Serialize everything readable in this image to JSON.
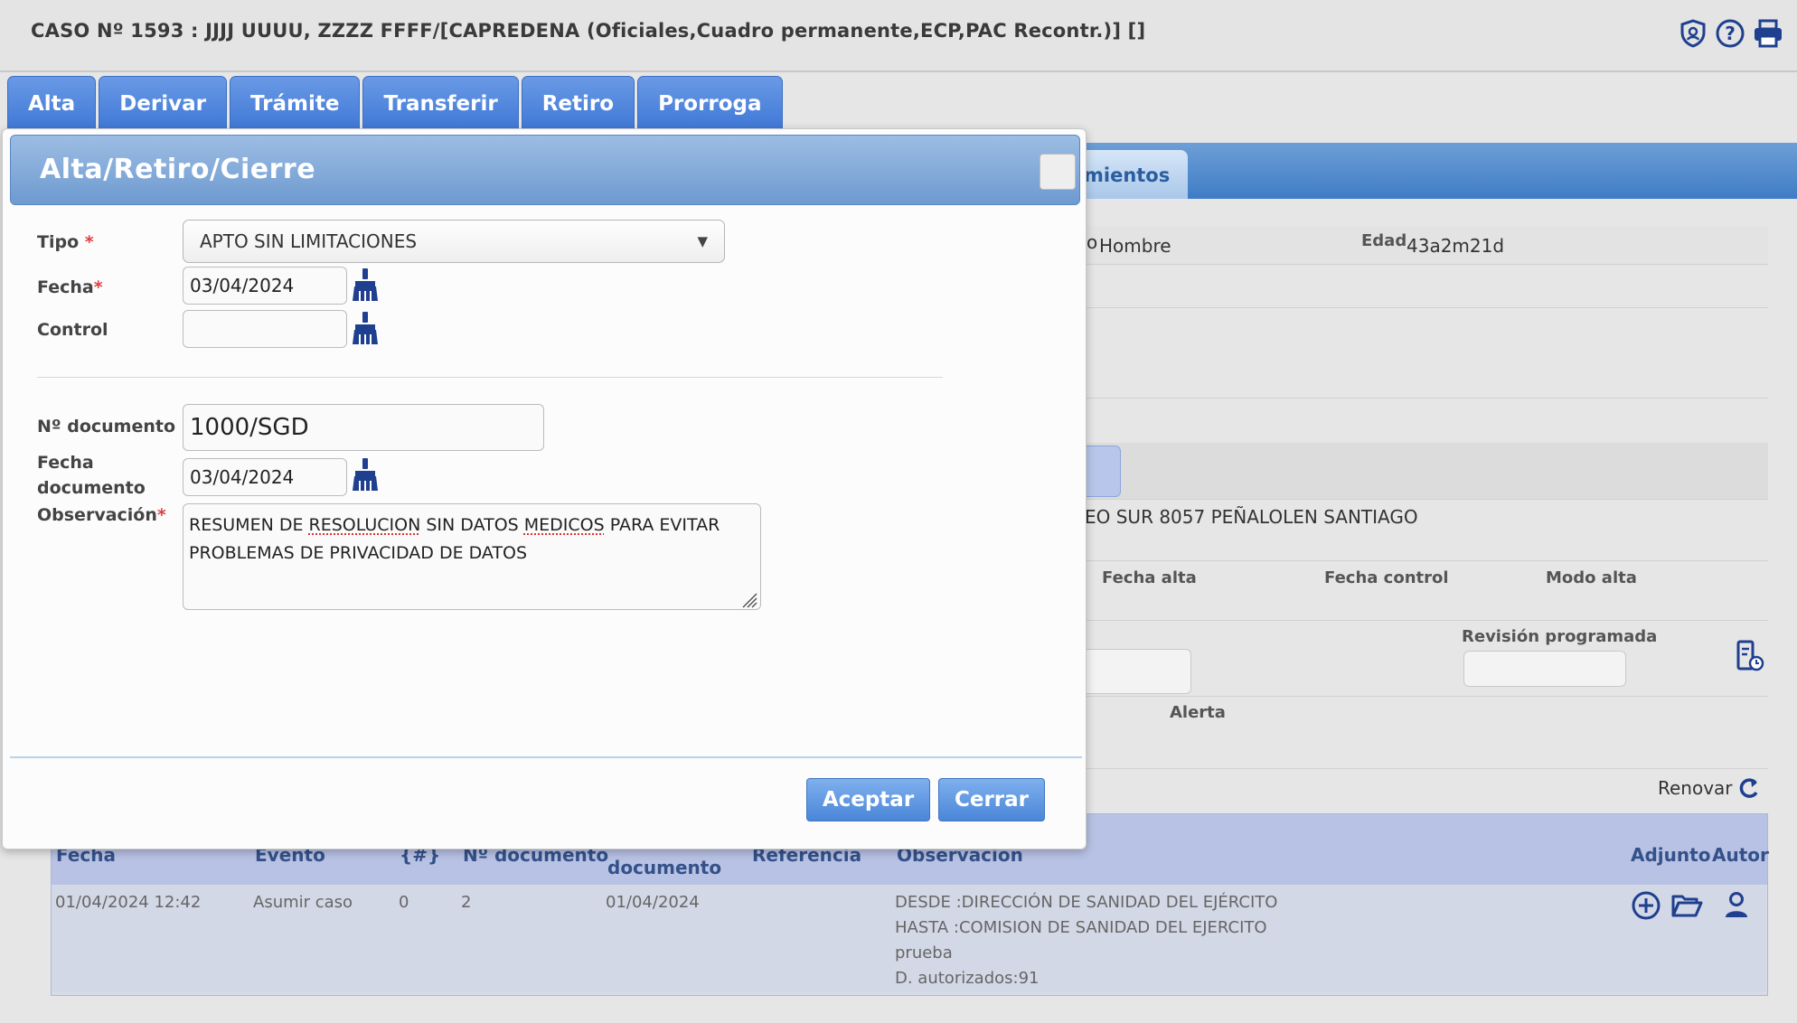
{
  "header": {
    "case_title": "CASO Nº 1593 : JJJJ UUUU, ZZZZ FFFF/[CAPREDENA (Oficiales,Cuadro permanente,ECP,PAC Recontr.)] []",
    "icons": [
      "shield-icon",
      "help-icon",
      "print-icon"
    ]
  },
  "tabs": [
    "Alta",
    "Derivar",
    "Trámite",
    "Transferir",
    "Retiro",
    "Prorroga"
  ],
  "background": {
    "tab_partial": "mientos",
    "sex_label": "o",
    "sex_value": "Hombre",
    "age_label": "Edad",
    "age_value": "43a2m21d",
    "address": "EO SUR 8057 PEÑALOLEN SANTIAGO",
    "col_fecha_alta": "Fecha alta",
    "col_fecha_control": "Fecha control",
    "col_modo_alta": "Modo alta",
    "revision_label": "Revisión programada",
    "alerta_label": "Alerta",
    "renovar_label": "Renovar",
    "history": {
      "headers": [
        "Fecha",
        "Evento",
        "{#}",
        "Nº documento",
        "documento",
        "Referencia",
        "Observacion",
        "Adjunto",
        "Autor"
      ],
      "row": {
        "fecha": "01/04/2024 12:42",
        "evento": "Asumir caso",
        "num": "0",
        "ndoc": "2",
        "fecha_doc": "01/04/2024",
        "obs_lines": [
          "DESDE :DIRECCIÓN DE SANIDAD DEL EJÉRCITO",
          "HASTA :COMISION DE SANIDAD DEL EJERCITO",
          "prueba",
          "D. autorizados:91"
        ]
      }
    }
  },
  "dialog": {
    "title": "Alta/Retiro/Cierre",
    "tipo_label": "Tipo",
    "tipo_value": "APTO SIN LIMITACIONES",
    "fecha_label": "Fecha",
    "fecha_value": "03/04/2024",
    "control_label": "Control",
    "control_value": "",
    "ndoc_label": "Nº documento",
    "ndoc_value": "1000/SGD",
    "fecha_doc_label_1": "Fecha",
    "fecha_doc_label_2": "documento",
    "fecha_doc_value": "03/04/2024",
    "obs_label": "Observación",
    "obs_line1_a": "RESUMEN DE ",
    "obs_line1_b": "RESOLUCION",
    "obs_line1_c": " SIN DATOS ",
    "obs_line1_d": "MEDICOS",
    "obs_line1_e": " PARA EVITAR",
    "obs_line2": "PROBLEMAS DE PRIVACIDAD DE DATOS",
    "required_mark": "*",
    "accept_label": "Aceptar",
    "close_label": "Cerrar"
  },
  "colors": {
    "tab_blue": "#4a84dc",
    "dialog_title": "#7fa6d6",
    "button_blue": "#5a94e0",
    "icon_navy": "#1f3f8f"
  }
}
